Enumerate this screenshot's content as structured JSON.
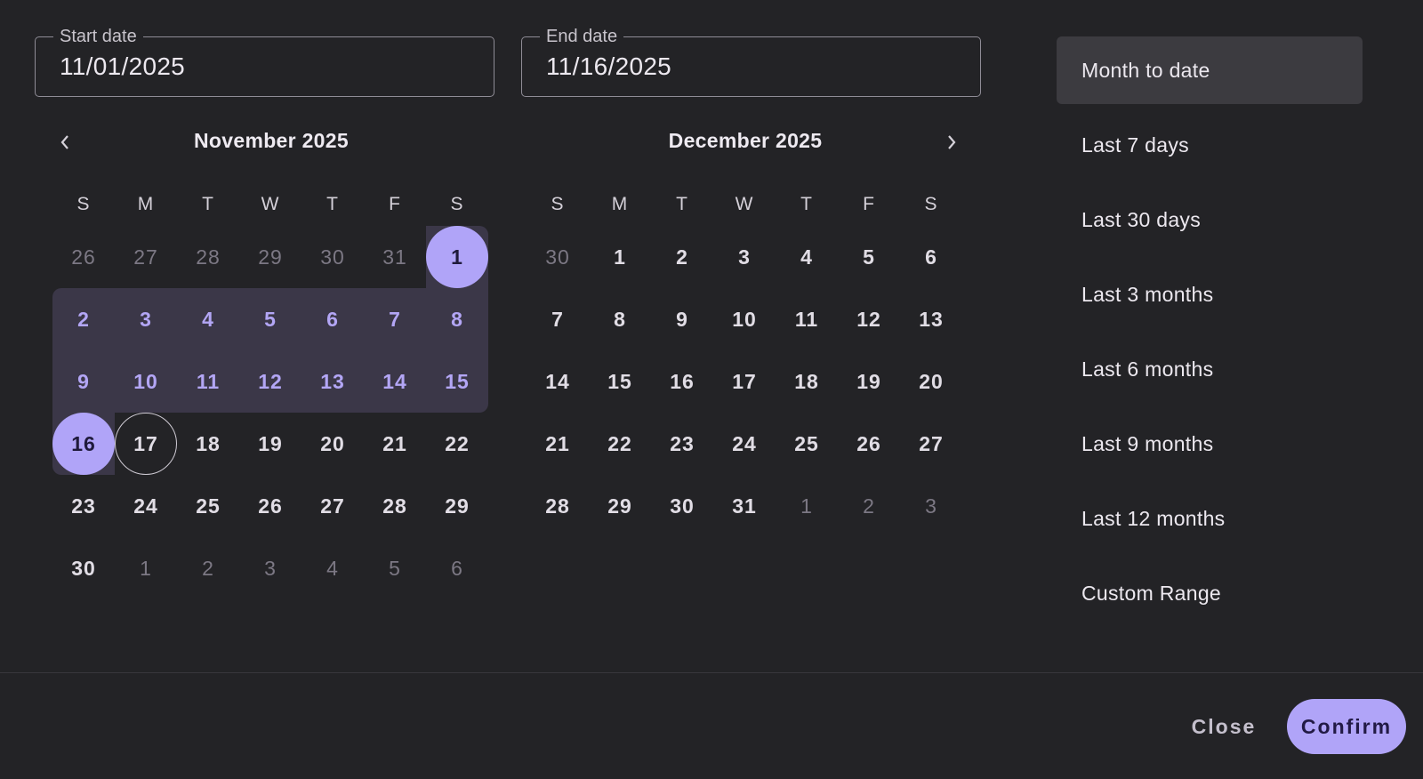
{
  "start": {
    "label": "Start date",
    "value": "11/01/2025"
  },
  "end": {
    "label": "End date",
    "value": "11/16/2025"
  },
  "weekdays": [
    "S",
    "M",
    "T",
    "W",
    "T",
    "F",
    "S"
  ],
  "left_month": {
    "title": "November 2025",
    "rows": [
      [
        "26",
        "27",
        "28",
        "29",
        "30",
        "31",
        "1"
      ],
      [
        "2",
        "3",
        "4",
        "5",
        "6",
        "7",
        "8"
      ],
      [
        "9",
        "10",
        "11",
        "12",
        "13",
        "14",
        "15"
      ],
      [
        "16",
        "17",
        "18",
        "19",
        "20",
        "21",
        "22"
      ],
      [
        "23",
        "24",
        "25",
        "26",
        "27",
        "28",
        "29"
      ],
      [
        "30",
        "1",
        "2",
        "3",
        "4",
        "5",
        "6"
      ]
    ]
  },
  "right_month": {
    "title": "December 2025",
    "rows": [
      [
        "30",
        "1",
        "2",
        "3",
        "4",
        "5",
        "6"
      ],
      [
        "7",
        "8",
        "9",
        "10",
        "11",
        "12",
        "13"
      ],
      [
        "14",
        "15",
        "16",
        "17",
        "18",
        "19",
        "20"
      ],
      [
        "21",
        "22",
        "23",
        "24",
        "25",
        "26",
        "27"
      ],
      [
        "28",
        "29",
        "30",
        "31",
        "1",
        "2",
        "3"
      ]
    ]
  },
  "presets": [
    "Month to date",
    "Last 7 days",
    "Last 30 days",
    "Last 3 months",
    "Last 6 months",
    "Last 9 months",
    "Last 12 months",
    "Custom Range"
  ],
  "actions": {
    "close": "Close",
    "confirm": "Confirm"
  }
}
